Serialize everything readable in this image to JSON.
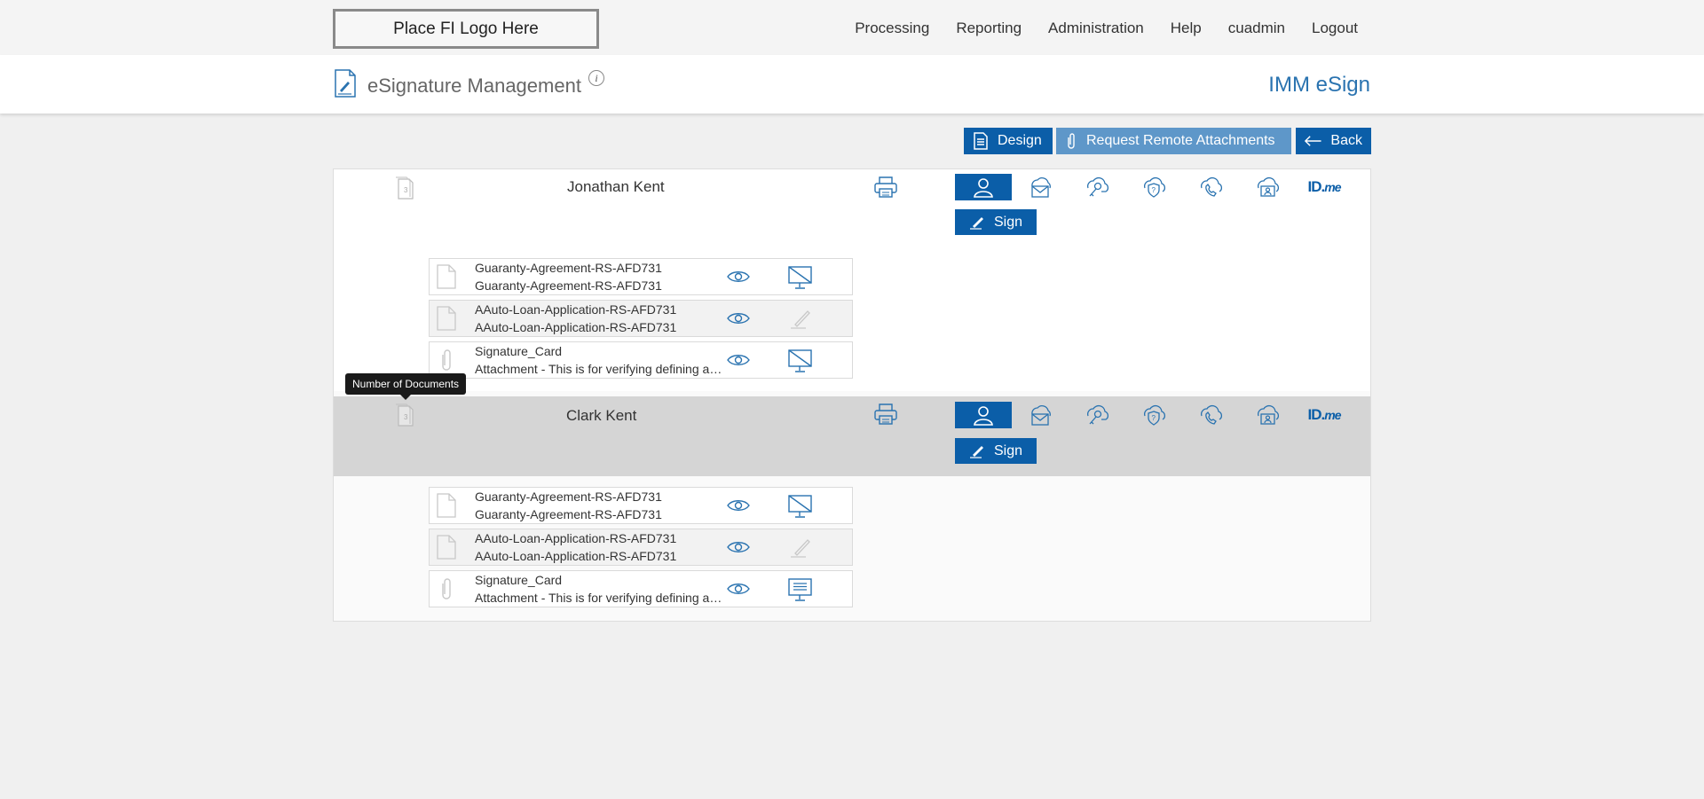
{
  "logo": {
    "text": "Place FI Logo Here"
  },
  "nav": {
    "items": [
      "Processing",
      "Reporting",
      "Administration",
      "Help",
      "cuadmin",
      "Logout"
    ]
  },
  "header": {
    "title": "eSignature Management",
    "info": "i",
    "brand": "IMM eSign"
  },
  "toolbar": {
    "design": "Design",
    "request": "Request Remote Attachments",
    "back": "Back"
  },
  "tooltip": "Number of Documents",
  "signers": [
    {
      "name": "Jonathan Kent",
      "sign_label": "Sign",
      "documents": [
        {
          "line1": "Guaranty-Agreement-RS-AFD731",
          "line2": "Guaranty-Agreement-RS-AFD731",
          "type": "document",
          "status": "monitor-crossed"
        },
        {
          "line1": "AAuto-Loan-Application-RS-AFD731",
          "line2": "AAuto-Loan-Application-RS-AFD731",
          "type": "document",
          "status": "pen-disabled"
        },
        {
          "line1": "Signature_Card",
          "line2": "Attachment - This is for verifying defining and validating",
          "type": "attachment",
          "status": "monitor-crossed"
        }
      ]
    },
    {
      "name": "Clark Kent",
      "sign_label": "Sign",
      "documents": [
        {
          "line1": "Guaranty-Agreement-RS-AFD731",
          "line2": "Guaranty-Agreement-RS-AFD731",
          "type": "document",
          "status": "monitor-crossed"
        },
        {
          "line1": "AAuto-Loan-Application-RS-AFD731",
          "line2": "AAuto-Loan-Application-RS-AFD731",
          "type": "document",
          "status": "pen-disabled"
        },
        {
          "line1": "Signature_Card",
          "line2": "Attachment - This is for verifying defining and validating",
          "type": "attachment",
          "status": "monitor-text"
        }
      ]
    }
  ],
  "auth_methods": [
    "in-person-icon",
    "email-icon",
    "cloud-key-icon",
    "cloud-question-icon",
    "cloud-phone-icon",
    "cloud-id-icon",
    "idme-logo"
  ],
  "idme": {
    "main": "ID.",
    "suffix": "me"
  },
  "colors": {
    "primary": "#0b5ea8",
    "primary_light": "#5e97c9",
    "brand_text": "#2a73b0"
  }
}
